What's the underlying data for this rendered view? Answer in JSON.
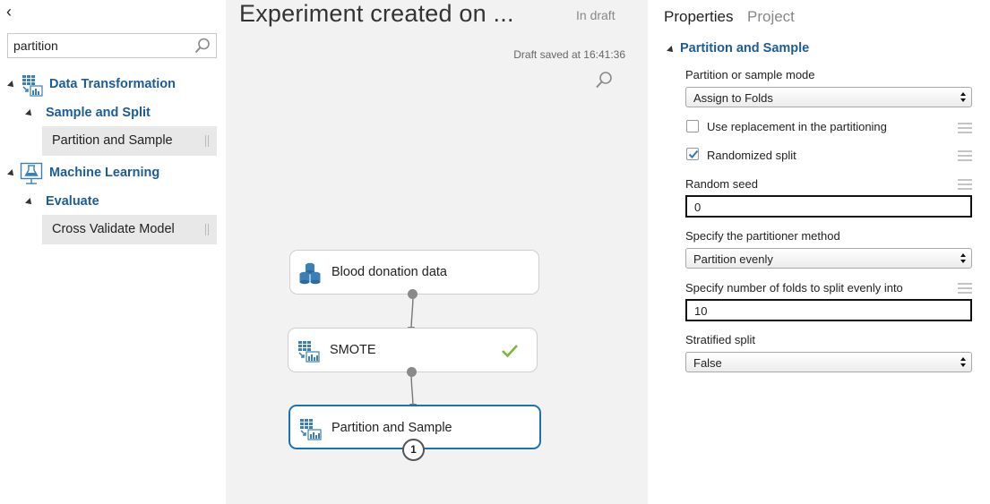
{
  "left_panel": {
    "collapse_glyph": "‹",
    "search": {
      "value": "partition",
      "placeholder": ""
    },
    "tree": {
      "data_transformation": "Data Transformation",
      "sample_and_split": "Sample and Split",
      "partition_and_sample": "Partition and Sample",
      "machine_learning": "Machine Learning",
      "evaluate": "Evaluate",
      "cross_validate_model": "Cross Validate Model"
    }
  },
  "canvas": {
    "title": "Experiment created on ...",
    "status": "In draft",
    "draft_saved": "Draft saved at 16:41:36",
    "nodes": {
      "blood": "Blood donation data",
      "smote": "SMOTE",
      "partition": "Partition and Sample"
    },
    "partition_badge": "1"
  },
  "properties": {
    "tabs": {
      "properties": "Properties",
      "project": "Project"
    },
    "section_title": "Partition and Sample",
    "mode_label": "Partition or sample mode",
    "mode_value": "Assign to Folds",
    "use_replacement_label": "Use replacement in the partitioning",
    "use_replacement_checked": false,
    "randomized_split_label": "Randomized split",
    "randomized_split_checked": true,
    "random_seed_label": "Random seed",
    "random_seed_value": "0",
    "partitioner_method_label": "Specify the partitioner method",
    "partitioner_method_value": "Partition evenly",
    "folds_label": "Specify number of folds to split evenly into",
    "folds_value": "10",
    "stratified_label": "Stratified split",
    "stratified_value": "False"
  },
  "colors": {
    "link_blue": "#1c5d95",
    "selected_border": "#1c73b4",
    "check_green": "#7ab935",
    "icon_blue": "#3a7fb7"
  }
}
